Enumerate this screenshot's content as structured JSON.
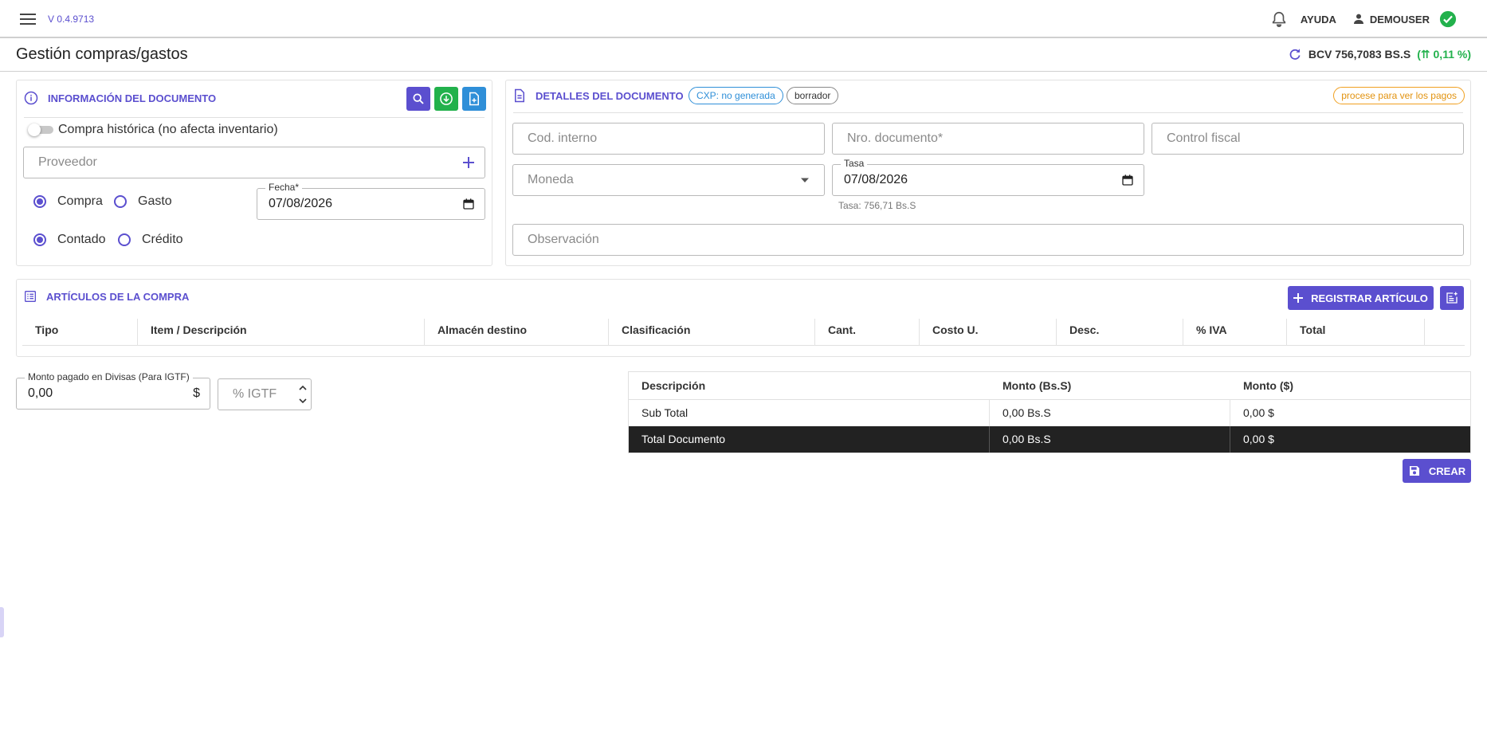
{
  "app": {
    "version": "V 0.4.9713",
    "help_label": "AYUDA",
    "user_name": "DEMOUSER"
  },
  "page": {
    "title": "Gestión compras/gastos"
  },
  "rate": {
    "label": "BCV 756,7083 BS.S",
    "change": "(⇈ 0,11 %)"
  },
  "doc_info": {
    "title": "INFORMACIÓN DEL DOCUMENTO",
    "historic_label": "Compra histórica (no afecta inventario)",
    "provider_placeholder": "Proveedor",
    "type_options": [
      "Compra",
      "Gasto"
    ],
    "type_selected": "Compra",
    "payment_options": [
      "Contado",
      "Crédito"
    ],
    "payment_selected": "Contado",
    "date_label": "Fecha*",
    "date_value": "07/08/2026"
  },
  "doc_details": {
    "title": "DETALLES DEL DOCUMENTO",
    "cxp_chip": "CXP: no generada",
    "status_chip": "borrador",
    "payments_chip": "procese para ver los pagos",
    "internal_code_placeholder": "Cod. interno",
    "doc_number_placeholder": "Nro. documento*",
    "fiscal_control_placeholder": "Control fiscal",
    "currency_placeholder": "Moneda",
    "rate_label": "Tasa",
    "rate_date": "07/08/2026",
    "rate_hint": "Tasa: 756,71 Bs.S",
    "observation_placeholder": "Observación"
  },
  "articles": {
    "title": "ARTÍCULOS DE LA COMPRA",
    "register_label": "REGISTRAR ARTÍCULO",
    "columns": [
      "Tipo",
      "Item / Descripción",
      "Almacén destino",
      "Clasificación",
      "Cant.",
      "Costo U.",
      "Desc.",
      "% IVA",
      "Total"
    ]
  },
  "igtf": {
    "currency_paid_label": "Monto pagado en Divisas (Para IGTF)",
    "currency_paid_value": "0,00",
    "currency_symbol": "$",
    "igtf_placeholder": "% IGTF"
  },
  "totals": {
    "headers": [
      "Descripción",
      "Monto (Bs.S)",
      "Monto ($)"
    ],
    "rows": [
      {
        "label": "Sub Total",
        "bs": "0,00 Bs.S",
        "usd": "0,00 $"
      },
      {
        "label": "Total Documento",
        "bs": "0,00 Bs.S",
        "usd": "0,00 $"
      }
    ]
  },
  "actions": {
    "create_label": "CREAR"
  },
  "colors": {
    "accent": "#5b4fcf",
    "success": "#22b14c",
    "info": "#2f8fd8",
    "warning": "#f0a020",
    "dark": "#222222"
  }
}
